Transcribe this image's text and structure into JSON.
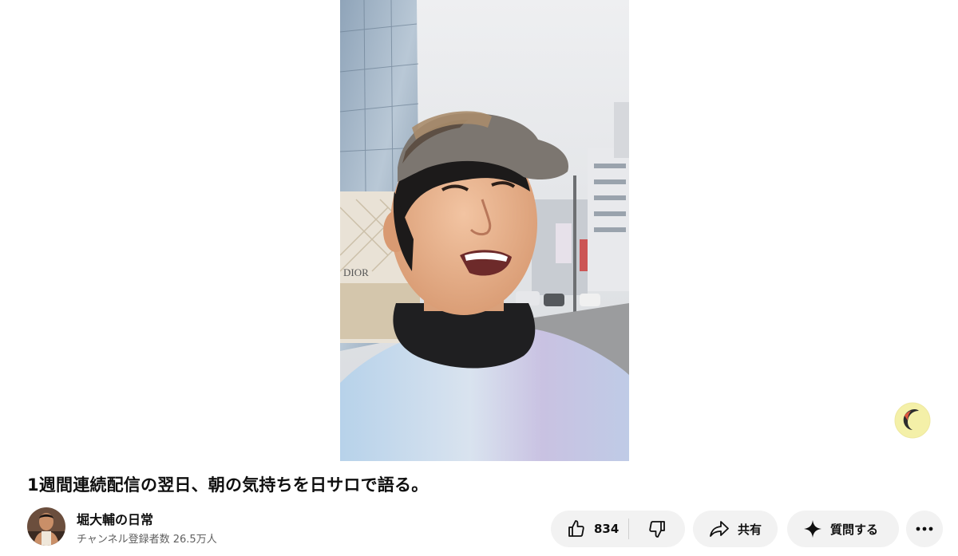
{
  "video": {
    "title": "1週間連続配信の翌日、朝の気持ちを日サロで語る。",
    "storefront_sign": "DIOR"
  },
  "channel": {
    "name": "堀大輔の日常",
    "subscribers": "チャンネル登録者数 26.5万人"
  },
  "actions": {
    "like_count": "834",
    "share_label": "共有",
    "ask_label": "質問する"
  },
  "icons": {
    "like": "thumbs-up-icon",
    "dislike": "thumbs-down-icon",
    "share": "share-arrow-icon",
    "ask": "sparkle-icon",
    "more": "more-horizontal-icon",
    "badge": "moon-icon"
  },
  "colors": {
    "pill_bg": "#f2f2f2",
    "text_primary": "#0f0f0f",
    "text_secondary": "#606060"
  }
}
